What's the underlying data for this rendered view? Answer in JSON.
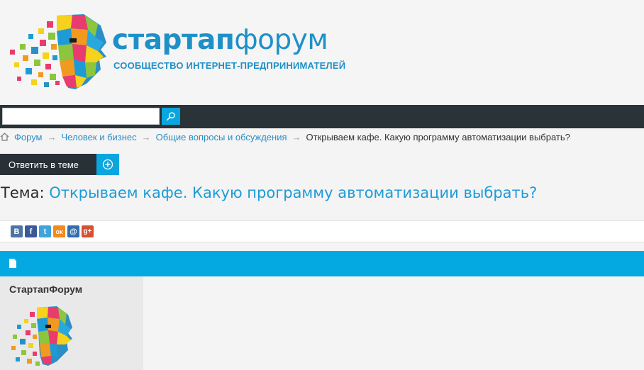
{
  "brand": {
    "name_part1": "стартап",
    "name_part2": "форум",
    "tagline": "СООБЩЕСТВО ИНТЕРНЕТ-ПРЕДПРИНИМАТЕЛЕЙ",
    "color": "#1e90c8"
  },
  "search": {
    "value": "",
    "placeholder": ""
  },
  "breadcrumb": {
    "items": [
      "Форум",
      "Человек и бизнес",
      "Общие вопросы и обсуждения"
    ],
    "current": "Открываем кафе. Какую программу автоматизации выбрать?",
    "separator": "→"
  },
  "actions": {
    "reply_label": "Ответить в теме"
  },
  "topic": {
    "prefix": "Тема:",
    "title": "Открываем кафе. Какую программу автоматизации выбрать?"
  },
  "share": {
    "buttons": [
      {
        "icon": "vk-icon",
        "glyph": "B",
        "color": "#4d75a3"
      },
      {
        "icon": "facebook-icon",
        "glyph": "f",
        "color": "#3b5998"
      },
      {
        "icon": "twitter-icon",
        "glyph": "t",
        "color": "#3fa3dc"
      },
      {
        "icon": "odnoklassniki-icon",
        "glyph": "ок",
        "color": "#f18a1f"
      },
      {
        "icon": "mailru-icon",
        "glyph": "@",
        "color": "#2f6eb0"
      },
      {
        "icon": "googleplus-icon",
        "glyph": "g+",
        "color": "#d8502f"
      }
    ]
  },
  "post": {
    "author": "СтартапФорум"
  },
  "colors": {
    "accent": "#04a9e1",
    "dark": "#283136"
  }
}
